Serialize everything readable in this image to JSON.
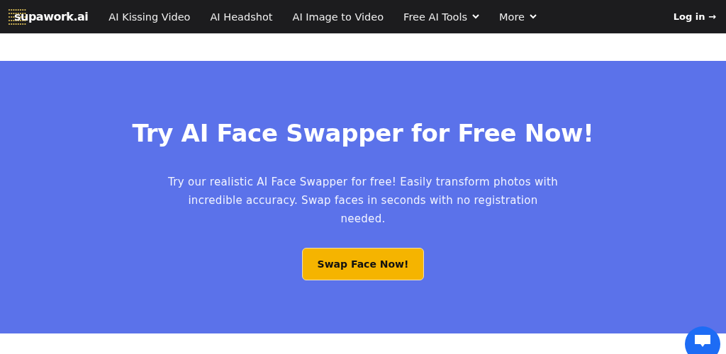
{
  "header": {
    "logo": "supawork.ai",
    "nav": [
      {
        "label": "AI Kissing Video",
        "kind": "link"
      },
      {
        "label": "AI Headshot",
        "kind": "link"
      },
      {
        "label": "AI Image to Video",
        "kind": "link"
      },
      {
        "label": "Free AI Tools",
        "kind": "dropdown"
      },
      {
        "label": "More",
        "kind": "dropdown"
      }
    ],
    "login": "Log in →"
  },
  "hero": {
    "title": "Try AI Face Swapper for Free Now!",
    "text": "Try our realistic AI Face Swapper for free! Easily transform photos with incredible accuracy. Swap faces in seconds with no registration needed.",
    "button": "Swap Face Now!"
  }
}
